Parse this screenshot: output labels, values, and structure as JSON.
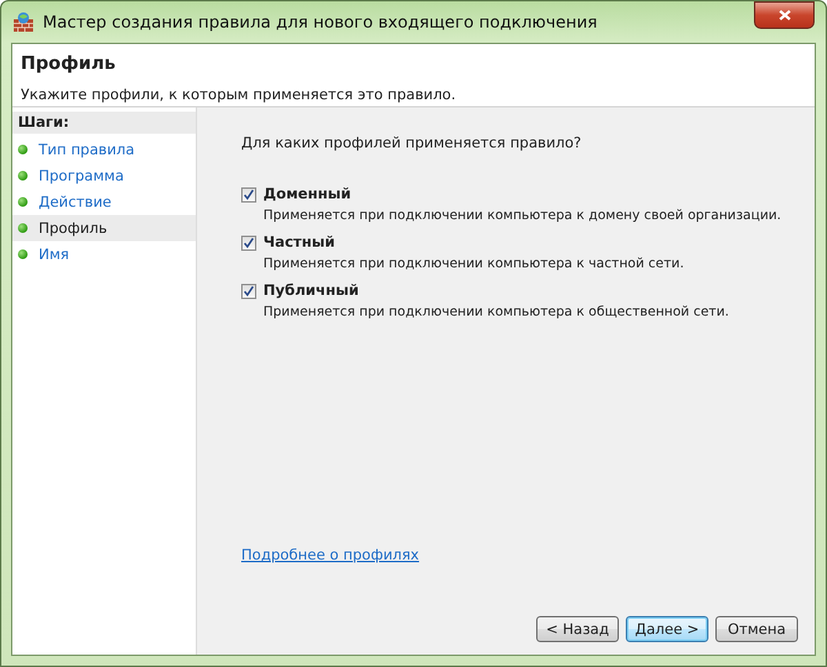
{
  "window": {
    "title": "Мастер создания правила для нового входящего подключения"
  },
  "header": {
    "title": "Профиль",
    "subtitle": "Укажите профили, к которым применяется это правило."
  },
  "steps": {
    "heading": "Шаги:",
    "items": [
      {
        "label": "Тип правила",
        "selected": false
      },
      {
        "label": "Программа",
        "selected": false
      },
      {
        "label": "Действие",
        "selected": false
      },
      {
        "label": "Профиль",
        "selected": true
      },
      {
        "label": "Имя",
        "selected": false
      }
    ]
  },
  "question": "Для каких профилей применяется правило?",
  "profiles": [
    {
      "label": "Доменный",
      "checked": true,
      "description": "Применяется при подключении компьютера к домену своей организации."
    },
    {
      "label": "Частный",
      "checked": true,
      "description": "Применяется при подключении компьютера к частной сети."
    },
    {
      "label": "Публичный",
      "checked": true,
      "description": "Применяется при подключении компьютера к общественной сети."
    }
  ],
  "link": "Подробнее о профилях",
  "buttons": [
    {
      "label": "< Назад",
      "default": false
    },
    {
      "label": "Далее >",
      "default": true
    },
    {
      "label": "Отмена",
      "default": false
    }
  ]
}
